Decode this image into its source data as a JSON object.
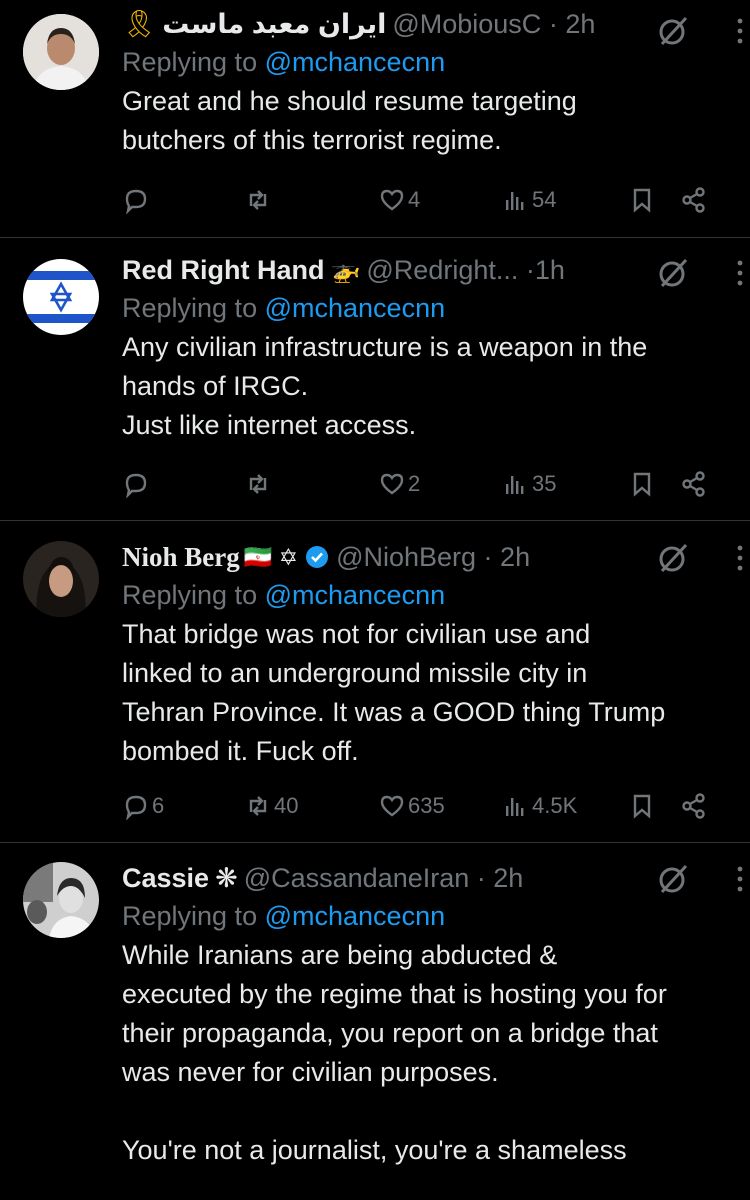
{
  "replies": [
    {
      "display_name": "ایران معبد ماست",
      "emoji": "🎗",
      "handle": "@MobiousC",
      "time": "2h",
      "replying_label": "Replying to",
      "replying_to": "@mchancecnn",
      "text": "Great and he should resume targeting\nbutchers of this terrorist regime.",
      "replies_count": "",
      "reposts_count": "",
      "likes_count": "4",
      "views_count": "54"
    },
    {
      "display_name": "Red Right Hand",
      "emoji": "🚁",
      "handle": "@Redright...",
      "time": "1h",
      "replying_label": "Replying to",
      "replying_to": "@mchancecnn",
      "text": "Any civilian infrastructure is a weapon in the\nhands of IRGC.\nJust like internet access.",
      "replies_count": "",
      "reposts_count": "",
      "likes_count": "2",
      "views_count": "35"
    },
    {
      "display_name": "Nioh Berg",
      "emoji": "🇮🇷 ✡",
      "handle": "@NiohBerg",
      "time": "2h",
      "replying_label": "Replying to",
      "replying_to": "@mchancecnn",
      "text": "That bridge was not for civilian use and\nlinked to an underground missile city in\nTehran Province. It was a GOOD thing Trump\nbombed it. Fuck off.",
      "replies_count": "6",
      "reposts_count": "40",
      "likes_count": "635",
      "views_count": "4.5K"
    },
    {
      "display_name": "Cassie",
      "emoji": "❋",
      "handle": "@CassandaneIran",
      "time": "2h",
      "replying_label": "Replying to",
      "replying_to": "@mchancecnn",
      "text": "While Iranians are being abducted &\nexecuted by the regime that is hosting you for\ntheir propaganda, you report on a bridge that\nwas never for civilian purposes.\n\nYou're not a journalist, you're a shameless",
      "replies_count": "",
      "reposts_count": "",
      "likes_count": "",
      "views_count": ""
    }
  ],
  "colors": {
    "background": "#000000",
    "text": "#e7e9ea",
    "muted": "#71767b",
    "link": "#1d9bf0",
    "verified": "#1d9bf0"
  }
}
